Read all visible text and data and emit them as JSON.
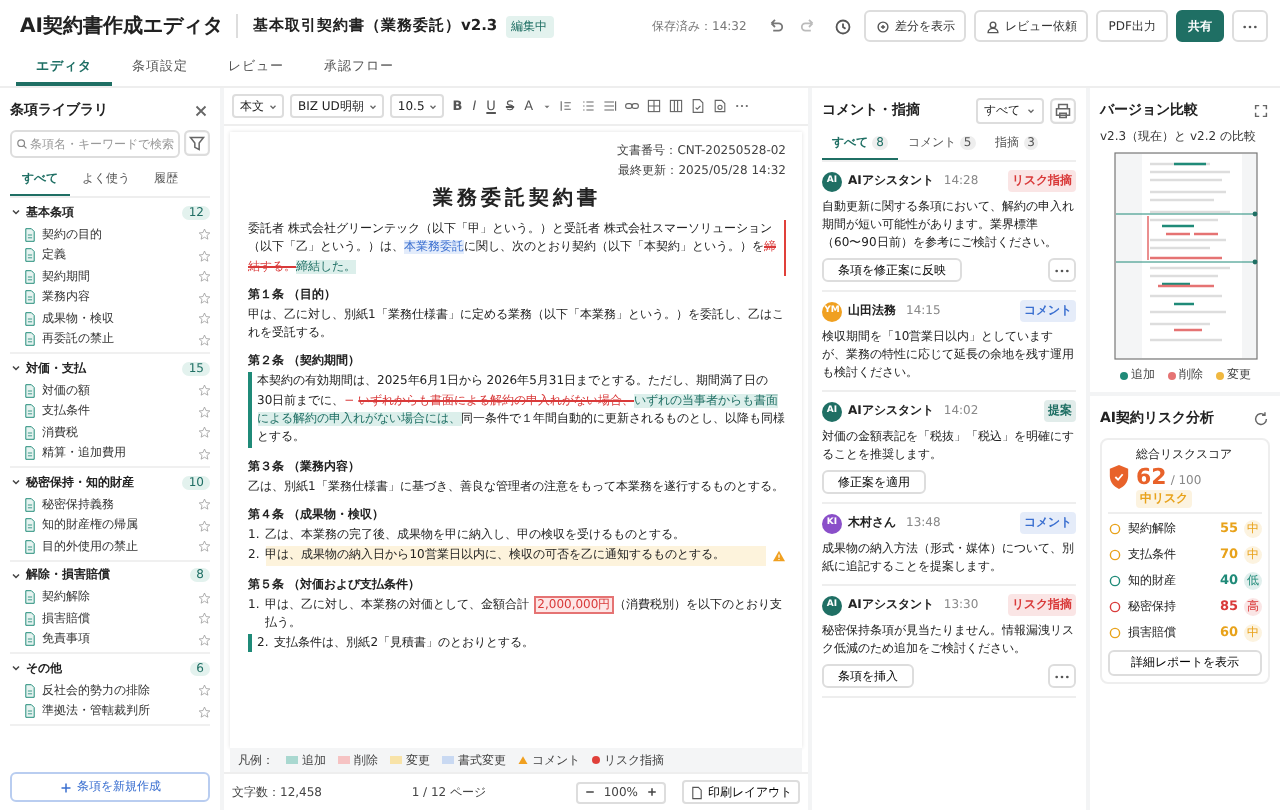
{
  "header": {
    "app_title": "AI契約書作成エディタ",
    "document_title": "基本取引契約書（業務委託）v2.3",
    "status": "編集中",
    "saved": "保存済み：14:32"
  },
  "header_buttons": [
    {
      "label": "差分を表示",
      "kind": "outline"
    },
    {
      "label": "レビュー依頼",
      "kind": "outline"
    },
    {
      "label": "PDF出力",
      "kind": "outline"
    },
    {
      "label": "共有",
      "kind": "primary"
    }
  ],
  "tabs": [
    {
      "label": "エディタ",
      "selected": true
    },
    {
      "label": "条項設定",
      "selected": false
    },
    {
      "label": "レビュー",
      "selected": false
    },
    {
      "label": "承認フロー",
      "selected": false
    }
  ],
  "library": {
    "title": "条項ライブラリ",
    "search_placeholder": "条項名・キーワードで検索",
    "tabs": [
      {
        "label": "すべて",
        "selected": true
      },
      {
        "label": "よく使う",
        "selected": false
      },
      {
        "label": "履歴",
        "selected": false
      }
    ],
    "groups": [
      {
        "name": "基本条項",
        "count": "12",
        "expanded": true,
        "items": [
          "契約の目的",
          "定義",
          "契約期間",
          "業務内容",
          "成果物・検収",
          "再委託の禁止"
        ]
      },
      {
        "name": "対価・支払",
        "count": "15",
        "expanded": true,
        "items": [
          "対価の額",
          "支払条件",
          "消費税",
          "精算・追加費用"
        ]
      },
      {
        "name": "秘密保持・知的財産",
        "count": "10",
        "expanded": true,
        "items": [
          "秘密保持義務",
          "知的財産権の帰属",
          "目的外使用の禁止"
        ]
      },
      {
        "name": "解除・損害賠償",
        "count": "8",
        "expanded": true,
        "items": [
          "契約解除",
          "損害賠償",
          "免責事項"
        ]
      },
      {
        "name": "その他",
        "count": "6",
        "expanded": true,
        "items": [
          "反社会的勢力の排除",
          "準拠法・管轄裁判所"
        ]
      }
    ],
    "add_button": "条項を新規作成"
  },
  "editor_toolbar": {
    "selects": [
      "本文",
      "BIZ UD明朝",
      "10.5"
    ],
    "format_buttons": [
      "B",
      "I",
      "U",
      "S",
      "A"
    ]
  },
  "document": {
    "meta": [
      "文書番号：CNT-20250528-02",
      "最終更新：2025/05/28 14:32"
    ],
    "title": "業務委託契約書",
    "blocks": [
      {
        "paragraphs": [
          {
            "kind": "right-bar",
            "segments": [
              {
                "kind": "plain",
                "text": "委託者 株式会社グリーンテック（以下「甲」という。）と受託者 株式会社スマーソリューション（以下「乙」という。）は、"
              },
              {
                "kind": "format",
                "text": "本業務委託"
              },
              {
                "kind": "plain",
                "text": "に関し、次のとおり契約（以下「本契約」という。）を"
              },
              {
                "kind": "deleted",
                "text": "締結する。"
              },
              {
                "kind": "added",
                "text": "締結した。"
              }
            ]
          }
        ]
      },
      {
        "heading": "第１条 （目的）",
        "paragraphs": [
          {
            "kind": "plain",
            "segments": [
              {
                "kind": "plain",
                "text": "甲は、乙に対し、別紙1「業務仕様書」に定める業務（以下「本業務」という。）を委託し、乙はこれを受託する。"
              }
            ]
          }
        ]
      },
      {
        "heading": "第２条 （契約期間）",
        "paragraphs": [
          {
            "kind": "left-bar",
            "segments": [
              {
                "kind": "plain",
                "text": "本契約の有効期間は、2025年6月1日から 2026年5月31日までとする。ただし、期間満了日の 30日前までに、"
              },
              {
                "kind": "marker",
                "text": "−"
              },
              {
                "kind": "deleted",
                "text": "いずれからも書面による解約の申入れがない場合、"
              },
              {
                "kind": "added",
                "text": "いずれの当事者からも書面による解約の申入れがない場合には、"
              },
              {
                "kind": "plain",
                "text": "同一条件で１年間自動的に更新されるものとし、以降も同様とする。"
              }
            ]
          }
        ]
      },
      {
        "heading": "第３条 （業務内容）",
        "paragraphs": [
          {
            "kind": "plain",
            "segments": [
              {
                "kind": "plain",
                "text": "乙は、別紙1「業務仕様書」に基づき、善良な管理者の注意をもって本業務を遂行するものとする。"
              }
            ]
          }
        ]
      },
      {
        "heading": "第４条 （成果物・検収）",
        "paragraphs": [
          {
            "number": "1.",
            "kind": "plain",
            "segments": [
              {
                "kind": "plain",
                "text": "乙は、本業務の完了後、成果物を甲に納入し、甲の検収を受けるものとする。"
              }
            ]
          },
          {
            "number": "2.",
            "kind": "warning",
            "segments": [
              {
                "kind": "plain",
                "text": "甲は、成果物の納入日から10営業日以内に、検収の可否を乙に通知するものとする。"
              }
            ]
          }
        ]
      },
      {
        "heading": "第５条 （対価および支払条件）",
        "paragraphs": [
          {
            "number": "1.",
            "kind": "plain",
            "segments": [
              {
                "kind": "plain",
                "text": "甲は、乙に対し、本業務の対価として、金額合計 "
              },
              {
                "kind": "risk",
                "text": "2,000,000円"
              },
              {
                "kind": "plain",
                "text": "（消費税別）を以下のとおり支払う。"
              }
            ]
          },
          {
            "number": "2.",
            "kind": "left-bar",
            "segments": [
              {
                "kind": "plain",
                "text": "支払条件は、別紙2「見積書」のとおりとする。"
              }
            ]
          }
        ]
      }
    ],
    "legend_label": "凡例：",
    "legend": [
      {
        "label": "追加",
        "kind": "swatch",
        "color": "#a9d8d0"
      },
      {
        "label": "削除",
        "kind": "swatch",
        "color": "#f6c3c3"
      },
      {
        "label": "変更",
        "kind": "swatch",
        "color": "#f8e3a8"
      },
      {
        "label": "書式変更",
        "kind": "swatch",
        "color": "#c9d9f2"
      },
      {
        "label": "コメント",
        "kind": "triangle",
        "color": "#f0a020"
      },
      {
        "label": "リスク指摘",
        "kind": "dot",
        "color": "#e0403a"
      }
    ]
  },
  "footer": {
    "char_count": "文字数：12,458",
    "page": "1",
    "page_sep": "/",
    "pages": "12",
    "page_unit": "ページ",
    "zoom": "100%",
    "print_button": "印刷レイアウト"
  },
  "comments": {
    "title": "コメント・指摘",
    "filter": "すべて",
    "tabs": [
      {
        "label": "すべて",
        "count": "8",
        "selected": true
      },
      {
        "label": "コメント",
        "count": "5",
        "selected": false
      },
      {
        "label": "指摘",
        "count": "3",
        "selected": false
      }
    ],
    "items": [
      {
        "initials": "AI",
        "color": "#1f6f64",
        "author": "AIアシスタント",
        "time": "14:28",
        "tag": {
          "text": "リスク指摘",
          "color": "#d93a3a"
        },
        "text": "自動更新に関する条項において、解約の申入れ期間が短い可能性があります。業界標準（60〜90日前）を参考にご検討ください。",
        "action": "条項を修正案に反映",
        "more": true
      },
      {
        "initials": "YM",
        "color": "#f0a020",
        "author": "山田法務",
        "time": "14:15",
        "tag": {
          "text": "コメント",
          "color": "#3a6fd0"
        },
        "text": "検収期間を「10営業日以内」としていますが、業務の特性に応じて延長の余地を残す運用も検討ください。",
        "more": false
      },
      {
        "initials": "AI",
        "color": "#1f6f64",
        "author": "AIアシスタント",
        "time": "14:02",
        "tag": {
          "text": "提案",
          "color": "#1f6f64"
        },
        "text": "対価の金額表記を「税抜」「税込」を明確にすることを推奨します。",
        "action": "修正案を適用",
        "more": false
      },
      {
        "initials": "KI",
        "color": "#8a4fc9",
        "author": "木村さん",
        "time": "13:48",
        "tag": {
          "text": "コメント",
          "color": "#3a6fd0"
        },
        "text": "成果物の納入方法（形式・媒体）について、別紙に追記することを提案します。",
        "more": false
      },
      {
        "initials": "AI",
        "color": "#1f6f64",
        "author": "AIアシスタント",
        "time": "13:30",
        "tag": {
          "text": "リスク指摘",
          "color": "#d93a3a"
        },
        "text": "秘密保持条項が見当たりません。情報漏洩リスク低減のため追加をご検討ください。",
        "action": "条項を挿入",
        "more": true
      }
    ]
  },
  "version": {
    "title": "バージョン比較",
    "subtitle": "v2.3（現在）と v2.2 の比較",
    "legend": [
      {
        "label": "追加",
        "color": "#1f8a78"
      },
      {
        "label": "削除",
        "color": "#e57373"
      },
      {
        "label": "変更",
        "color": "#f0b840"
      }
    ]
  },
  "risk": {
    "title": "AI契約リスク分析",
    "score_label": "総合リスクスコア",
    "score": "62",
    "score_max": "/ 100",
    "badge": {
      "text": "中リスク",
      "color": "#e8a21a"
    },
    "rows": [
      {
        "name": "契約解除",
        "score": "55",
        "grade": "中",
        "color": "#e8a21a"
      },
      {
        "name": "支払条件",
        "score": "70",
        "grade": "中",
        "color": "#e8a21a"
      },
      {
        "name": "知的財産",
        "score": "40",
        "grade": "低",
        "color": "#1f8a78"
      },
      {
        "name": "秘密保持",
        "score": "85",
        "grade": "高",
        "color": "#d93a3a"
      },
      {
        "name": "損害賠償",
        "score": "60",
        "grade": "中",
        "color": "#e8a21a"
      }
    ],
    "button": "詳細レポートを表示"
  }
}
